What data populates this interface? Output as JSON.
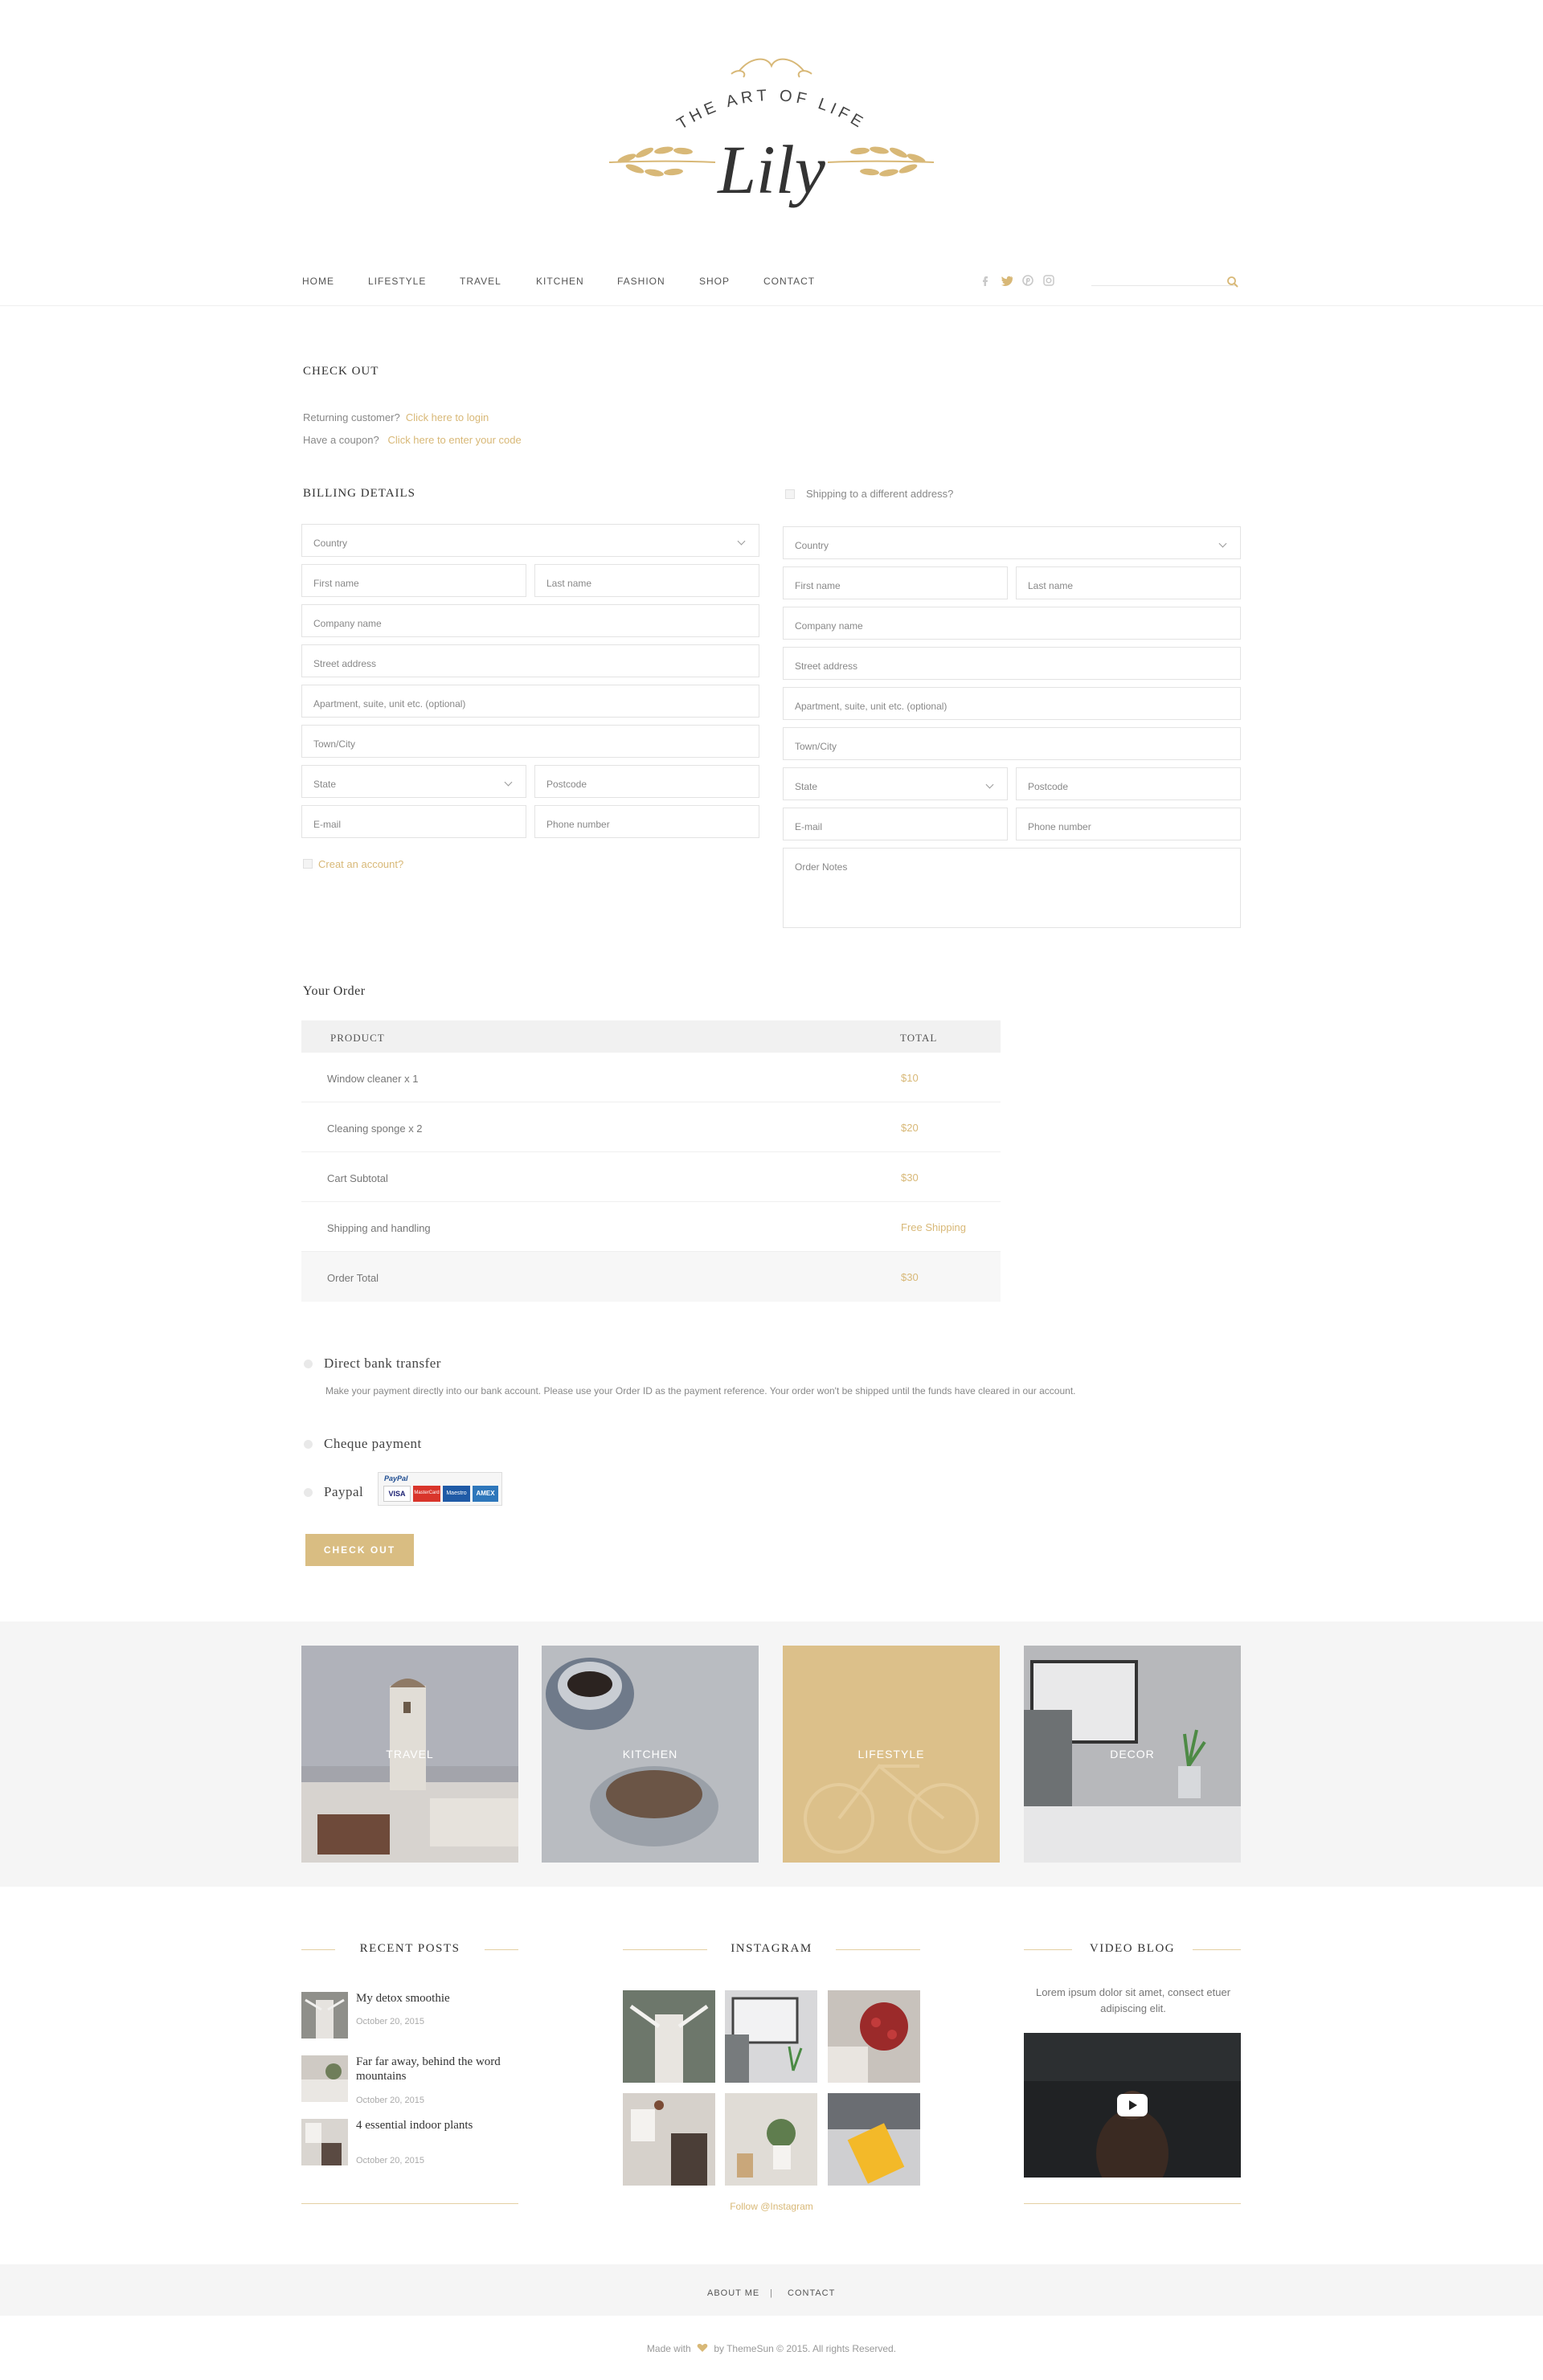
{
  "logo": {
    "tagline": "THE ART OF LIFE",
    "name": "Lily"
  },
  "nav": {
    "items": [
      "HOME",
      "LIFESTYLE",
      "TRAVEL",
      "KITCHEN",
      "FASHION",
      "SHOP",
      "CONTACT"
    ],
    "social": [
      "facebook-icon",
      "twitter-icon",
      "pinterest-icon",
      "instagram-icon"
    ]
  },
  "checkout": {
    "title": "CHECK OUT",
    "returning_text": "Returning customer?",
    "returning_link": "Click here to login",
    "coupon_text": "Have a coupon?",
    "coupon_link": "Click here to enter your code"
  },
  "billing": {
    "title": "BILLING DETAILS",
    "country": "Country",
    "first_name": "First name",
    "last_name": "Last name",
    "company": "Company name",
    "street": "Street address",
    "apartment": "Apartment, suite, unit etc. (optional)",
    "town": "Town/City",
    "state": "State",
    "postcode": "Postcode",
    "email": "E-mail",
    "phone": "Phone number",
    "create_account": "Creat an account?"
  },
  "shipping": {
    "toggle_label": "Shipping to a different address?",
    "country": "Country",
    "first_name": "First name",
    "last_name": "Last name",
    "company": "Company name",
    "street": "Street address",
    "apartment": "Apartment, suite, unit etc. (optional)",
    "town": "Town/City",
    "state": "State",
    "postcode": "Postcode",
    "email": "E-mail",
    "phone": "Phone number",
    "notes": "Order Notes"
  },
  "order": {
    "title": "Your Order",
    "col_product": "PRODUCT",
    "col_total": "TOTAL",
    "rows": [
      {
        "product": "Window cleaner x 1",
        "total": "$10"
      },
      {
        "product": "Cleaning sponge x 2",
        "total": "$20"
      },
      {
        "product": "Cart Subtotal",
        "total": "$30"
      },
      {
        "product": "Shipping and handling",
        "total": "Free Shipping"
      },
      {
        "product": "Order Total",
        "total": "$30"
      }
    ]
  },
  "payment": {
    "bank_label": "Direct bank transfer",
    "bank_desc": "Make your payment directly into our bank account. Please use your Order ID as the payment reference. Your order won't be shipped until the funds have cleared in our account.",
    "cheque_label": "Cheque payment",
    "paypal_label": "Paypal",
    "paypal_brand": "PayPal",
    "cards": [
      "VISA",
      "MasterCard",
      "Maestro",
      "AMEX"
    ],
    "checkout_button": "CHECK OUT"
  },
  "categories": [
    "TRAVEL",
    "KITCHEN",
    "LIFESTYLE",
    "DECOR"
  ],
  "widgets": {
    "recent_title": "RECENT POSTS",
    "recent_posts": [
      {
        "title": "My detox smoothie",
        "date": "October 20, 2015"
      },
      {
        "title": "Far far away, behind the word mountains",
        "date": "October 20, 2015"
      },
      {
        "title": "4 essential indoor plants",
        "date": "October 20, 2015"
      }
    ],
    "instagram_title": "INSTAGRAM",
    "instagram_follow": "Follow @Instagram",
    "video_title": "VIDEO BLOG",
    "video_text": "Lorem ipsum dolor sit amet, consect etuer adipiscing elit."
  },
  "footer": {
    "about": "ABOUT ME",
    "separator": "|",
    "contact": "CONTACT",
    "made_with": "Made with",
    "credit": "by ThemeSun © 2015. All rights Reserved."
  },
  "colors": {
    "accent": "#d9bd82",
    "text": "#777777",
    "heading": "#333333"
  }
}
